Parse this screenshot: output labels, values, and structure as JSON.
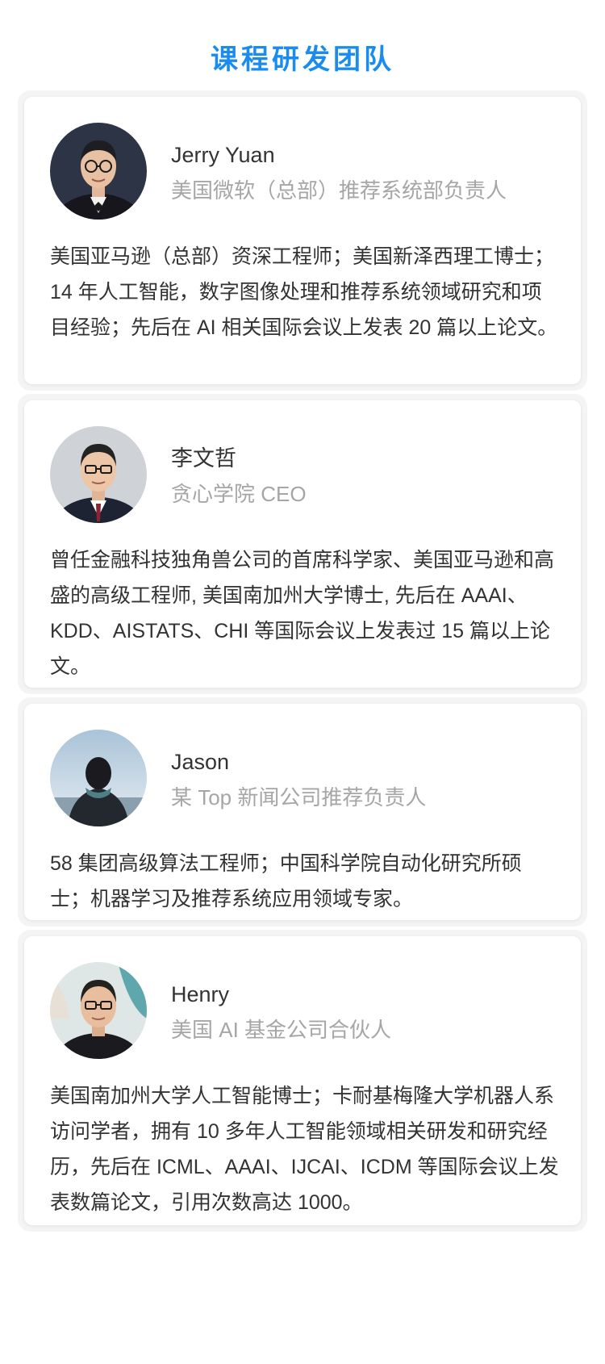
{
  "page_title": "课程研发团队",
  "colors": {
    "title": "#1a8cf0",
    "name": "#333333",
    "role": "#a6a6a6",
    "bio": "#333333"
  },
  "members": [
    {
      "name": "Jerry Yuan",
      "role": "美国微软（总部）推荐系统部负责人",
      "bio": "美国亚马逊（总部）资深工程师；美国新泽西理工博士；14 年人工智能，数字图像处理和推荐系统领域研究和项目经验；先后在 AI 相关国际会议上发表 20 篇以上论文。",
      "avatar_icon": "person-avatar-icon"
    },
    {
      "name": "李文哲",
      "role": "贪心学院 CEO",
      "bio": "曾任金融科技独角兽公司的首席科学家、美国亚马逊和高盛的高级工程师, 美国南加州大学博士, 先后在 AAAI、KDD、AISTATS、CHI 等国际会议上发表过 15 篇以上论文。",
      "avatar_icon": "person-avatar-icon"
    },
    {
      "name": "Jason",
      "role": "某 Top 新闻公司推荐负责人",
      "bio": "58 集团高级算法工程师；中国科学院自动化研究所硕士；机器学习及推荐系统应用领域专家。",
      "avatar_icon": "person-back-view-avatar-icon"
    },
    {
      "name": "Henry",
      "role": "美国 AI 基金公司合伙人",
      "bio": "美国南加州大学人工智能博士；卡耐基梅隆大学机器人系访问学者，拥有 10 多年人工智能领域相关研发和研究经历，先后在 ICML、AAAI、IJCAI、ICDM 等国际会议上发表数篇论文，引用次数高达 1000。",
      "avatar_icon": "person-avatar-icon"
    }
  ]
}
